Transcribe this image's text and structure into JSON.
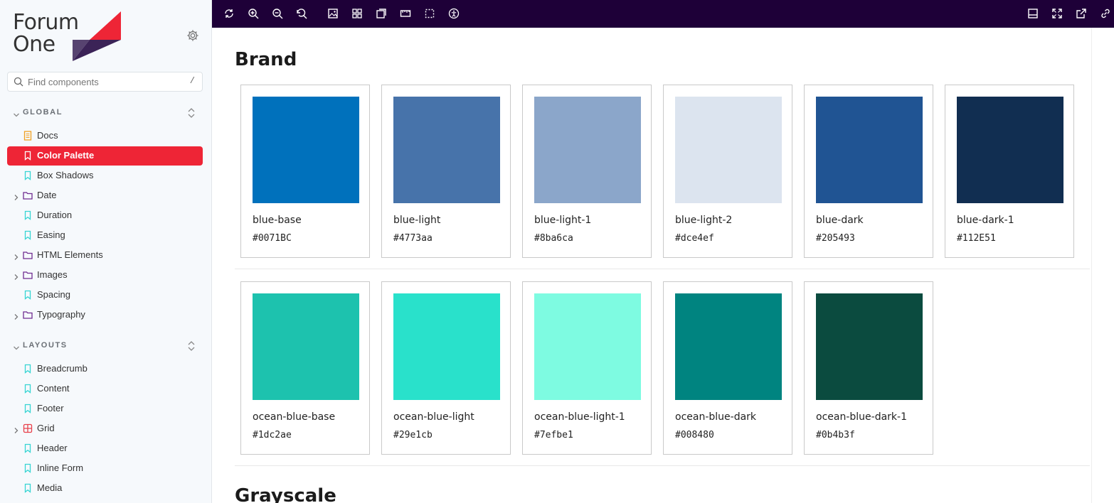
{
  "brand": {
    "logo_line1": "Forum",
    "logo_line2": "One",
    "primary_color": "#ee2536",
    "secondary_color": "#3b2357"
  },
  "search": {
    "placeholder": "Find components",
    "shortcut": "/"
  },
  "sidebar": {
    "sections": [
      {
        "label": "GLOBAL",
        "items": [
          {
            "label": "Docs",
            "type": "doc",
            "icon": "document-icon"
          },
          {
            "label": "Color Palette",
            "type": "story",
            "icon": "bookmark-icon",
            "active": true
          },
          {
            "label": "Box Shadows",
            "type": "story",
            "icon": "bookmark-icon"
          },
          {
            "label": "Date",
            "type": "folder",
            "icon": "folder-icon"
          },
          {
            "label": "Duration",
            "type": "story",
            "icon": "bookmark-icon"
          },
          {
            "label": "Easing",
            "type": "story",
            "icon": "bookmark-icon"
          },
          {
            "label": "HTML Elements",
            "type": "folder",
            "icon": "folder-icon"
          },
          {
            "label": "Images",
            "type": "folder",
            "icon": "folder-icon"
          },
          {
            "label": "Spacing",
            "type": "story",
            "icon": "bookmark-icon"
          },
          {
            "label": "Typography",
            "type": "folder",
            "icon": "folder-icon"
          }
        ]
      },
      {
        "label": "LAYOUTS",
        "items": [
          {
            "label": "Breadcrumb",
            "type": "story",
            "icon": "bookmark-icon"
          },
          {
            "label": "Content",
            "type": "story",
            "icon": "bookmark-icon"
          },
          {
            "label": "Footer",
            "type": "story",
            "icon": "bookmark-icon"
          },
          {
            "label": "Grid",
            "type": "component",
            "icon": "grid-component-icon"
          },
          {
            "label": "Header",
            "type": "story",
            "icon": "bookmark-icon"
          },
          {
            "label": "Inline Form",
            "type": "story",
            "icon": "bookmark-icon"
          },
          {
            "label": "Media",
            "type": "story",
            "icon": "bookmark-icon"
          }
        ]
      }
    ]
  },
  "toolbar": {
    "left_icons": [
      "reload-icon",
      "zoom-in-icon",
      "zoom-out-icon",
      "zoom-reset-icon",
      "background-icon",
      "grid-icon",
      "viewport-icon",
      "measure-icon",
      "outline-icon",
      "accessibility-icon"
    ],
    "right_icons": [
      "addons-panel-icon",
      "fullscreen-icon",
      "open-new-tab-icon",
      "copy-link-icon"
    ]
  },
  "main": {
    "sections": [
      {
        "heading": "Brand",
        "rows": [
          [
            {
              "name": "blue-base",
              "hex": "#0071BC",
              "color": "#0071BC"
            },
            {
              "name": "blue-light",
              "hex": "#4773aa",
              "color": "#4773aa"
            },
            {
              "name": "blue-light-1",
              "hex": "#8ba6ca",
              "color": "#8ba6ca"
            },
            {
              "name": "blue-light-2",
              "hex": "#dce4ef",
              "color": "#dce4ef"
            },
            {
              "name": "blue-dark",
              "hex": "#205493",
              "color": "#205493"
            },
            {
              "name": "blue-dark-1",
              "hex": "#112E51",
              "color": "#112E51"
            }
          ],
          [
            {
              "name": "ocean-blue-base",
              "hex": "#1dc2ae",
              "color": "#1dc2ae"
            },
            {
              "name": "ocean-blue-light",
              "hex": "#29e1cb",
              "color": "#29e1cb"
            },
            {
              "name": "ocean-blue-light-1",
              "hex": "#7efbe1",
              "color": "#7efbe1"
            },
            {
              "name": "ocean-blue-dark",
              "hex": "#008480",
              "color": "#008480"
            },
            {
              "name": "ocean-blue-dark-1",
              "hex": "#0b4b3f",
              "color": "#0b4b3f"
            }
          ]
        ]
      },
      {
        "heading": "Grayscale",
        "rows": []
      }
    ]
  }
}
